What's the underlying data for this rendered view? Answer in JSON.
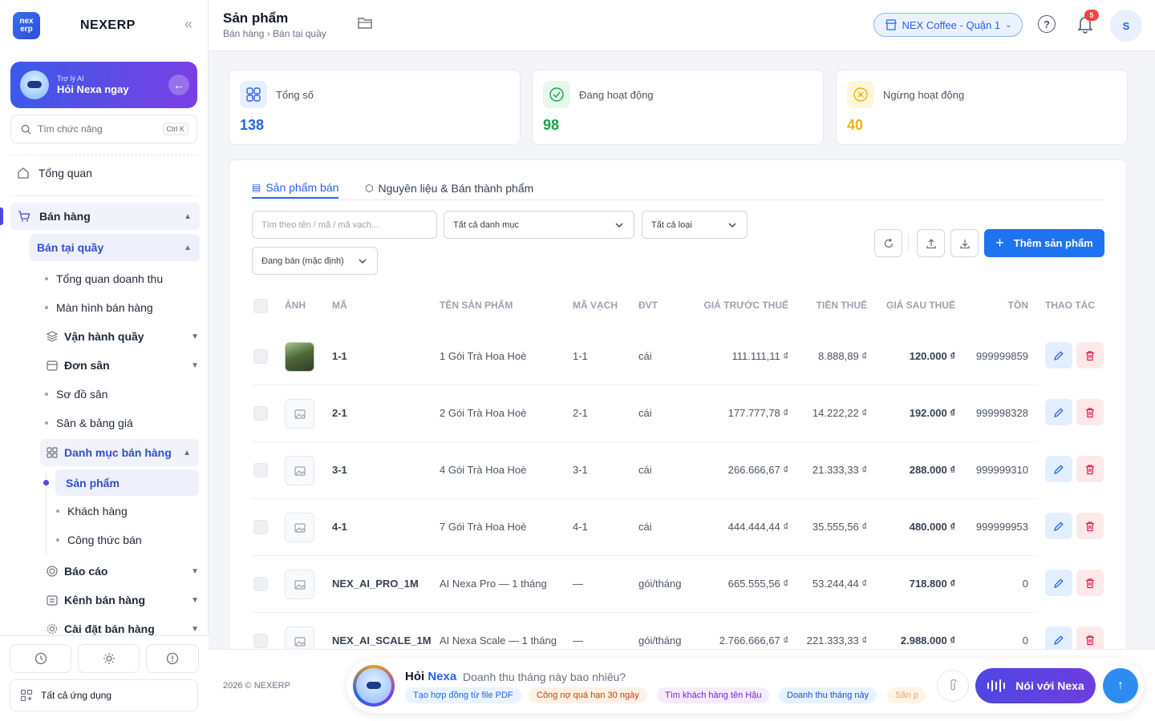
{
  "sidebar": {
    "brand_short": "nex erp",
    "brand": "NEXERP",
    "collapse_icon": "«",
    "ai": {
      "small": "Trợ lý AI",
      "big": "Hỏi Nexa ngay"
    },
    "search": {
      "placeholder": "Tìm chức năng",
      "shortcut": "Ctrl K"
    },
    "overview": "Tổng quan",
    "sales": "Bán hàng",
    "counter": "Bán tại quầy",
    "items": [
      "Tổng quan doanh thu",
      "Màn hình bán hàng",
      "Vận hành quầy",
      "Đơn sân",
      "Sơ đồ sân",
      "Sân & bảng giá",
      "Danh mục bán hàng",
      "Sản phẩm",
      "Khách hàng",
      "Công thức bán",
      "Báo cáo",
      "Kênh bán hàng",
      "Cài đặt bán hàng"
    ],
    "all_apps": "Tất cả ứng dụng"
  },
  "header": {
    "title": "Sản phẩm",
    "breadcrumb": "Bán hàng › Bán tại quầy",
    "store": "NEX Coffee - Quận 1",
    "help": "?",
    "notifications": "5",
    "avatar": "S"
  },
  "stats": [
    {
      "label": "Tổng số",
      "value": "138",
      "color": "#2563eb"
    },
    {
      "label": "Đang hoạt động",
      "value": "98",
      "color": "#16a34a"
    },
    {
      "label": "Ngừng hoạt động",
      "value": "40",
      "color": "#eab308"
    }
  ],
  "tabs": [
    "Sản phẩm bán",
    "Nguyên liệu & Bán thành phẩm"
  ],
  "filters": {
    "search_placeholder": "Tìm theo tên / mã / mã vạch...",
    "category": "Tất cả danh mục",
    "type": "Tất cả loại",
    "status": "Đang bán (mặc định)",
    "add": "Thêm sản phẩm"
  },
  "columns": [
    "ẢNH",
    "MÃ",
    "TÊN SẢN PHẨM",
    "MÃ VẠCH",
    "ĐVT",
    "GIÁ TRƯỚC THUẾ",
    "TIỀN THUẾ",
    "GIÁ SAU THUẾ",
    "TỒN",
    "THAO TÁC"
  ],
  "rows": [
    {
      "code": "1-1",
      "name": "1 Gói Trà Hoa Hoè",
      "barcode": "1-1",
      "unit": "cái",
      "pre": "111.111,11 ₫",
      "tax": "8.888,89 ₫",
      "post": "120.000 ₫",
      "stock": "999999859"
    },
    {
      "code": "2-1",
      "name": "2 Gói Trà Hoa Hoè",
      "barcode": "2-1",
      "unit": "cái",
      "pre": "177.777,78 ₫",
      "tax": "14.222,22 ₫",
      "post": "192.000 ₫",
      "stock": "999998328"
    },
    {
      "code": "3-1",
      "name": "4 Gói Trà Hoa Hoè",
      "barcode": "3-1",
      "unit": "cái",
      "pre": "266.666,67 ₫",
      "tax": "21.333,33 ₫",
      "post": "288.000 ₫",
      "stock": "999999310"
    },
    {
      "code": "4-1",
      "name": "7 Gói Trà Hoa Hoè",
      "barcode": "4-1",
      "unit": "cái",
      "pre": "444.444,44 ₫",
      "tax": "35.555,56 ₫",
      "post": "480.000 ₫",
      "stock": "999999953"
    },
    {
      "code": "NEX_AI_PRO_1M",
      "name": "AI Nexa Pro — 1 tháng",
      "barcode": "—",
      "unit": "gói/tháng",
      "pre": "665.555,56 ₫",
      "tax": "53.244,44 ₫",
      "post": "718.800 ₫",
      "stock": "0"
    },
    {
      "code": "NEX_AI_SCALE_1M",
      "name": "AI Nexa Scale — 1 tháng",
      "barcode": "—",
      "unit": "gói/tháng",
      "pre": "2.766.666,67 ₫",
      "tax": "221.333,33 ₫",
      "post": "2.988.000 ₫",
      "stock": "0"
    }
  ],
  "footer": {
    "copyright": "2026 © NEXERP",
    "ask": "Hỏi",
    "nexa": "Nexa",
    "question": "Doanh thu tháng này bao nhiêu?",
    "chips": [
      "Tạo hợp đồng từ file PDF",
      "Công nợ quá hạn 30 ngày",
      "Tìm khách hàng tên Hậu",
      "Doanh thu tháng này",
      "Sản p"
    ],
    "speak": "Nói với Nexa"
  },
  "icons": [
    "home-icon",
    "cart-icon",
    "layers-icon",
    "calendar-icon",
    "grid-icon",
    "chart-icon",
    "store-icon",
    "gear-icon",
    "history-icon",
    "sun-icon",
    "alert-icon",
    "apps-icon",
    "folder-icon",
    "bell-icon",
    "refresh-icon",
    "upload-icon",
    "download-icon",
    "image-icon",
    "edit-icon",
    "trash-icon",
    "paperclip-icon",
    "waveform-icon",
    "send-icon"
  ]
}
